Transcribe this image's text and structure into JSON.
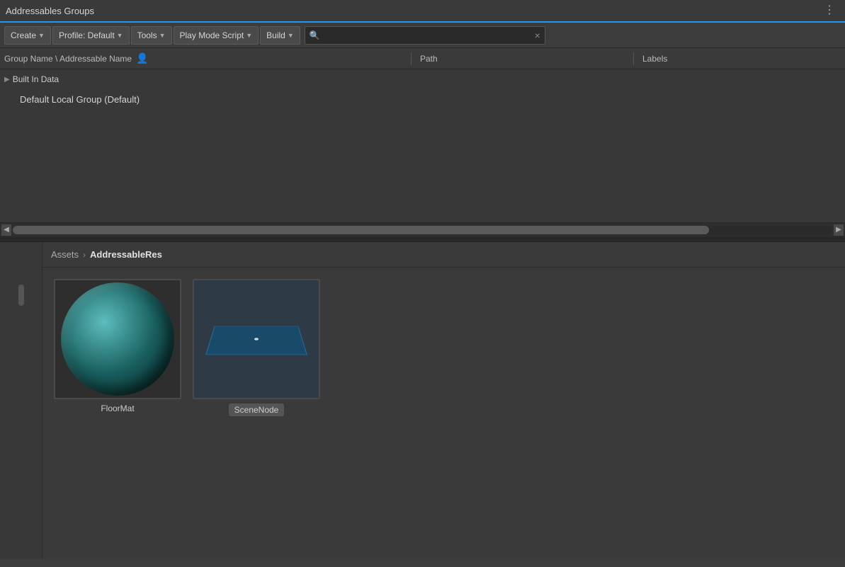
{
  "titleBar": {
    "title": "Addressables Groups",
    "menuDotsLabel": "⋮"
  },
  "toolbar": {
    "createLabel": "Create",
    "profileLabel": "Profile: Default",
    "toolsLabel": "Tools",
    "playModeLabel": "Play Mode Script",
    "buildLabel": "Build",
    "searchPlaceholder": "",
    "searchClearLabel": "×"
  },
  "columns": {
    "nameLabel": "Group Name \\ Addressable Name",
    "iconLabel": "⬛",
    "pathLabel": "Path",
    "labelsLabel": "Labels"
  },
  "treeItems": [
    {
      "type": "group",
      "label": "Built In Data",
      "expanded": false
    },
    {
      "type": "child",
      "label": "Default Local Group (Default)"
    }
  ],
  "bottomPanel": {
    "breadcrumb": {
      "assets": "Assets",
      "arrow": "›",
      "current": "AddressableRes"
    },
    "assets": [
      {
        "id": "floormat",
        "name": "FloorMat",
        "type": "sphere"
      },
      {
        "id": "scenenode",
        "name": "SceneNode",
        "type": "plane"
      }
    ]
  },
  "scrollbar": {
    "leftArrow": "◀",
    "rightArrow": "▶"
  }
}
